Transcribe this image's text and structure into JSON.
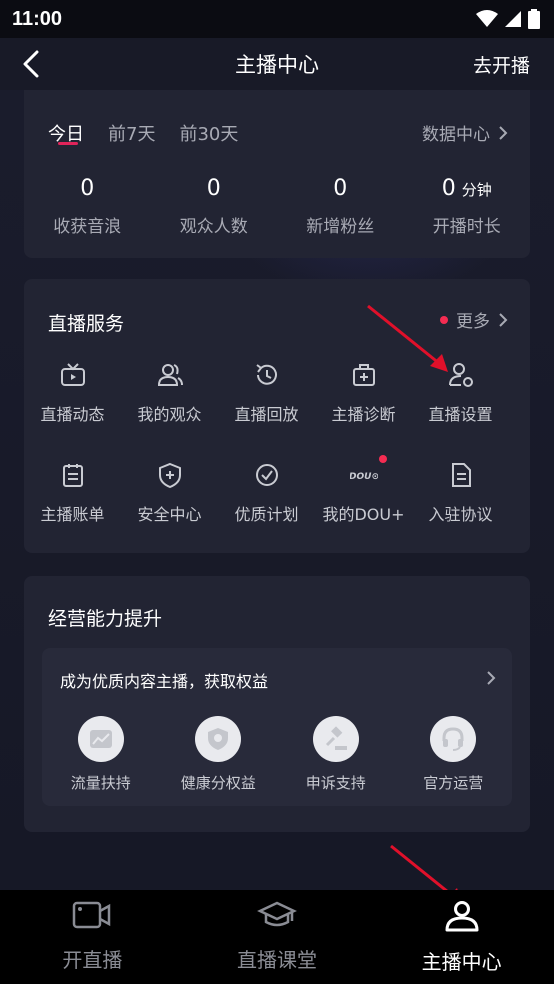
{
  "status_bar": {
    "time": "11:00"
  },
  "nav": {
    "back_icon": "back-arrow-icon",
    "title": "主播中心",
    "action": "去开播"
  },
  "stats": {
    "tabs": [
      {
        "label": "今日",
        "active": true
      },
      {
        "label": "前7天",
        "active": false
      },
      {
        "label": "前30天",
        "active": false
      }
    ],
    "data_center": "数据中心",
    "items": [
      {
        "value": "0",
        "unit": "",
        "label": "收获音浪"
      },
      {
        "value": "0",
        "unit": "",
        "label": "观众人数"
      },
      {
        "value": "0",
        "unit": "",
        "label": "新增粉丝"
      },
      {
        "value": "0",
        "unit": "分钟",
        "label": "开播时长"
      }
    ]
  },
  "services": {
    "title": "直播服务",
    "more": "更多",
    "items": [
      {
        "label": "直播动态",
        "icon": "tv-icon"
      },
      {
        "label": "我的观众",
        "icon": "users-icon"
      },
      {
        "label": "直播回放",
        "icon": "history-icon"
      },
      {
        "label": "主播诊断",
        "icon": "medkit-icon"
      },
      {
        "label": "直播设置",
        "icon": "user-settings-icon"
      },
      {
        "label": "主播账单",
        "icon": "clipboard-icon"
      },
      {
        "label": "安全中心",
        "icon": "shield-icon"
      },
      {
        "label": "优质计划",
        "icon": "check-circle-icon"
      },
      {
        "label": "我的DOU+",
        "icon": "dou-icon",
        "icon_text": "DOU⊙"
      },
      {
        "label": "入驻协议",
        "icon": "document-icon"
      }
    ]
  },
  "ops": {
    "title": "经营能力提升",
    "banner": "成为优质内容主播，获取权益",
    "items": [
      {
        "label": "流量扶持",
        "icon": "traffic-chart-icon"
      },
      {
        "label": "健康分权益",
        "icon": "shield-badge-icon"
      },
      {
        "label": "申诉支持",
        "icon": "gavel-icon"
      },
      {
        "label": "官方运营",
        "icon": "headset-icon"
      }
    ]
  },
  "bottom_nav": [
    {
      "label": "开直播",
      "icon": "video-camera-icon",
      "active": false
    },
    {
      "label": "直播课堂",
      "icon": "graduation-cap-icon",
      "active": false
    },
    {
      "label": "主播中心",
      "icon": "person-icon",
      "active": true
    }
  ],
  "colors": {
    "accent_red": "#f52c52",
    "background": "#161826",
    "card": "#222433"
  }
}
